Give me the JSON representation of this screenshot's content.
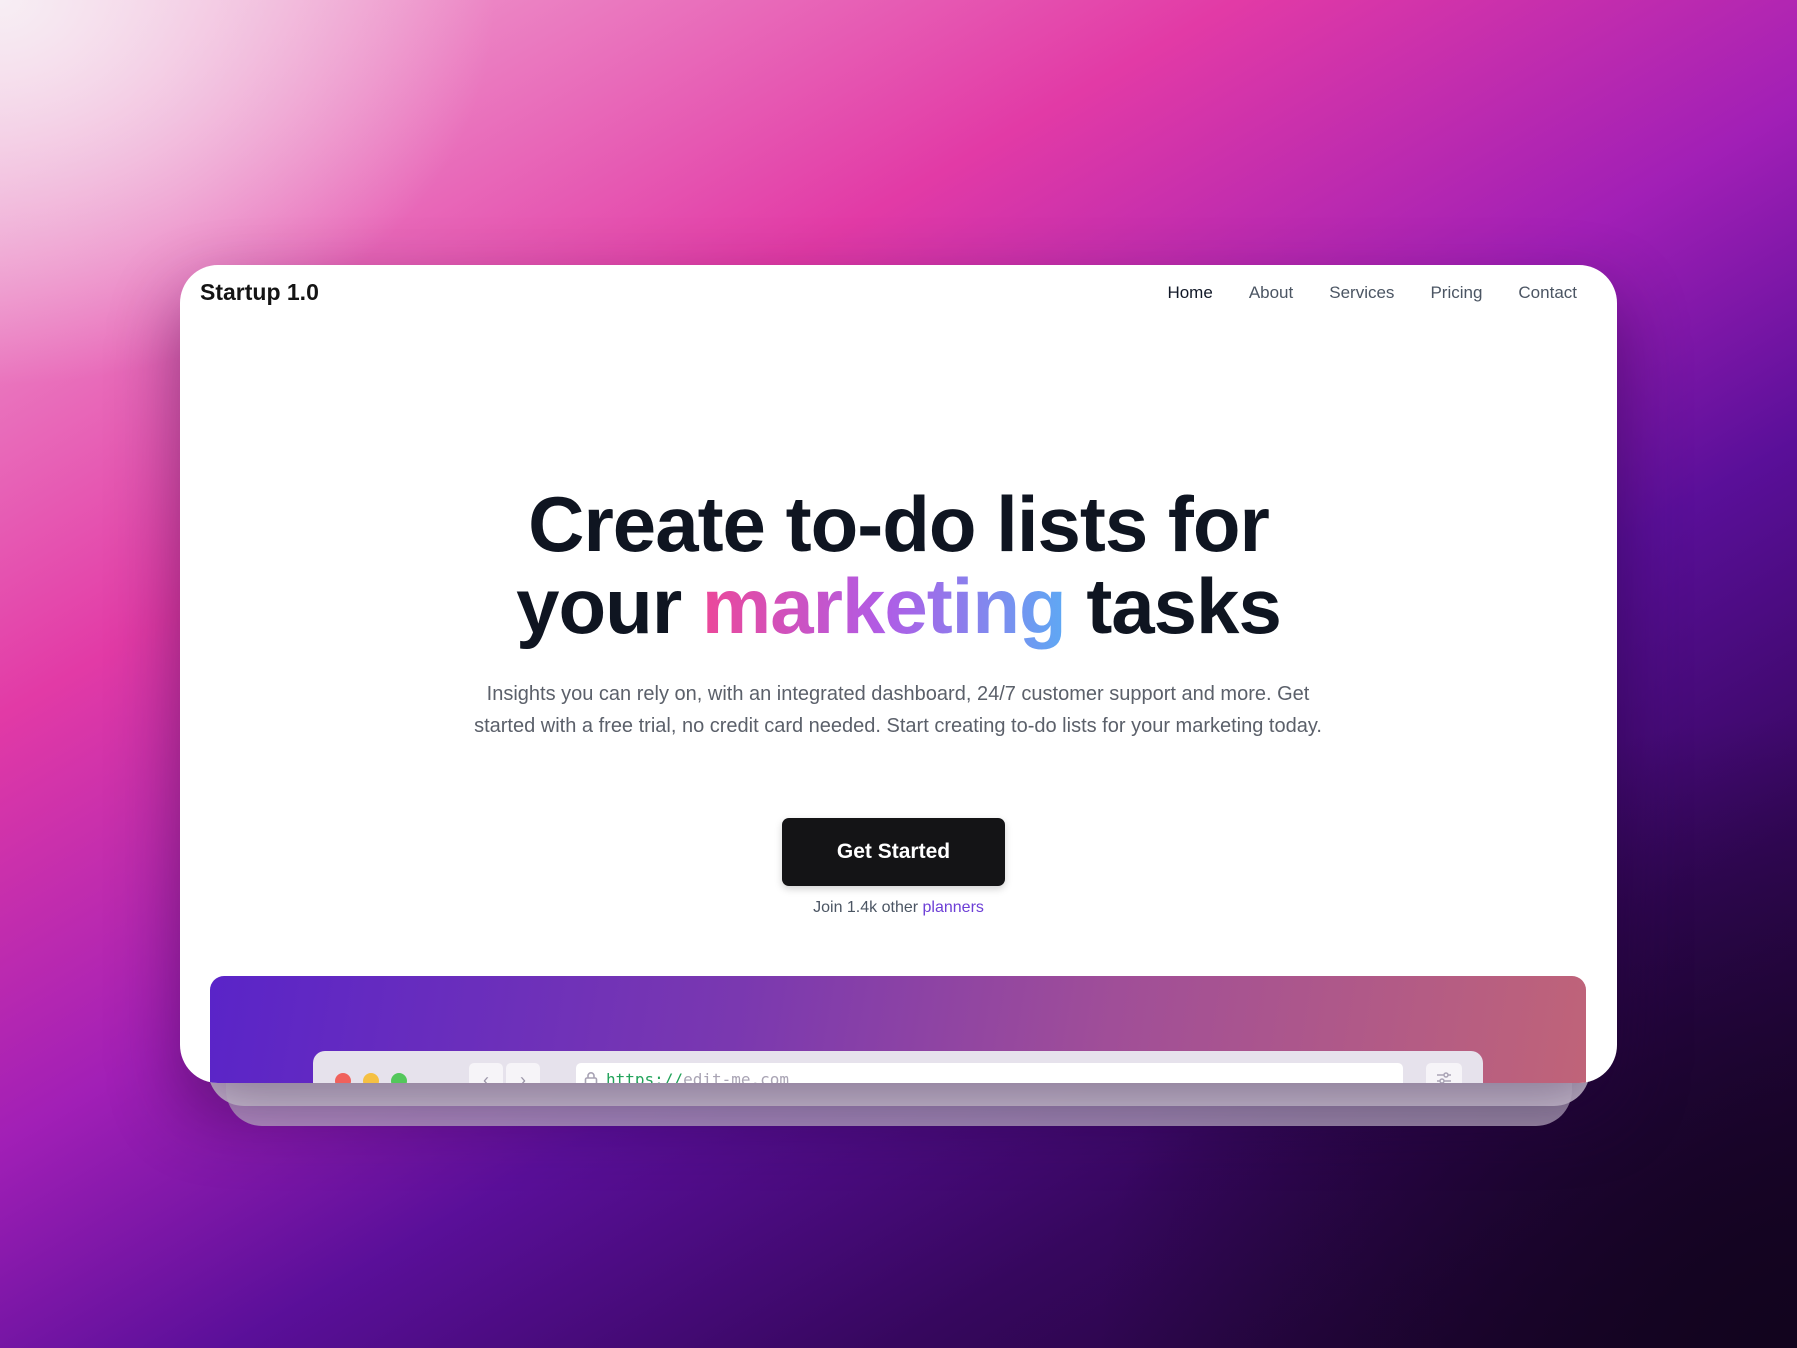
{
  "brand": "Startup 1.0",
  "nav": [
    "Home",
    "About",
    "Services",
    "Pricing",
    "Contact"
  ],
  "hero": {
    "line1": "Create to-do lists for",
    "line2_pre": "your ",
    "line2_highlight": "marketing",
    "line2_post": " tasks",
    "subtitle": "Insights you can rely on, with an integrated dashboard, 24/7 customer support and more. Get started with a free trial, no credit card needed. Start creating to-do lists for your marketing today.",
    "cta": "Get Started",
    "social_pre": "Join 1.4k other ",
    "social_link": "planners"
  },
  "browser": {
    "url_scheme": "https://",
    "url_host": "edit-me.com"
  },
  "colors": {
    "highlight_gradient": [
      "#ec4899",
      "#b05ce6",
      "#5ea9f4"
    ],
    "cta_bg": "#141416",
    "link": "#6d3fd6"
  },
  "icons": [
    "lock-icon",
    "chevron-left-icon",
    "chevron-right-icon",
    "sliders-icon"
  ]
}
